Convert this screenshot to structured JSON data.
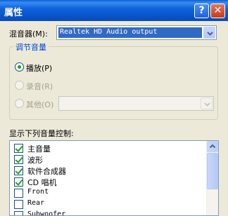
{
  "window": {
    "title": "属性",
    "help_label": "?",
    "close_label": "✕"
  },
  "mixer": {
    "label": "混音器(M):",
    "value": "Realtek HD Audio output"
  },
  "adjust_group": {
    "legend": "调节音量",
    "options": [
      {
        "label": "播放(P)",
        "selected": true,
        "enabled": true
      },
      {
        "label": "录音(R)",
        "selected": false,
        "enabled": false
      },
      {
        "label": "其他(O)",
        "selected": false,
        "enabled": false
      }
    ]
  },
  "controls": {
    "label": "显示下列音量控制:",
    "items": [
      {
        "label": "主音量",
        "checked": true
      },
      {
        "label": "波形",
        "checked": true
      },
      {
        "label": "软件合成器",
        "checked": true
      },
      {
        "label": "CD 唱机",
        "checked": true
      },
      {
        "label": "Front",
        "checked": false
      },
      {
        "label": "Rear",
        "checked": false
      },
      {
        "label": "Subwoofer",
        "checked": false
      }
    ]
  },
  "icons": {
    "dropdown": "chevron-down-icon",
    "scroll_up": "arrow-up-icon",
    "scroll_down": "arrow-down-icon",
    "check": "checkmark-icon"
  },
  "colors": {
    "titlebar": "#0a5fd8",
    "selection": "#316ac5",
    "legend": "#0046d5",
    "check": "#21a121"
  }
}
